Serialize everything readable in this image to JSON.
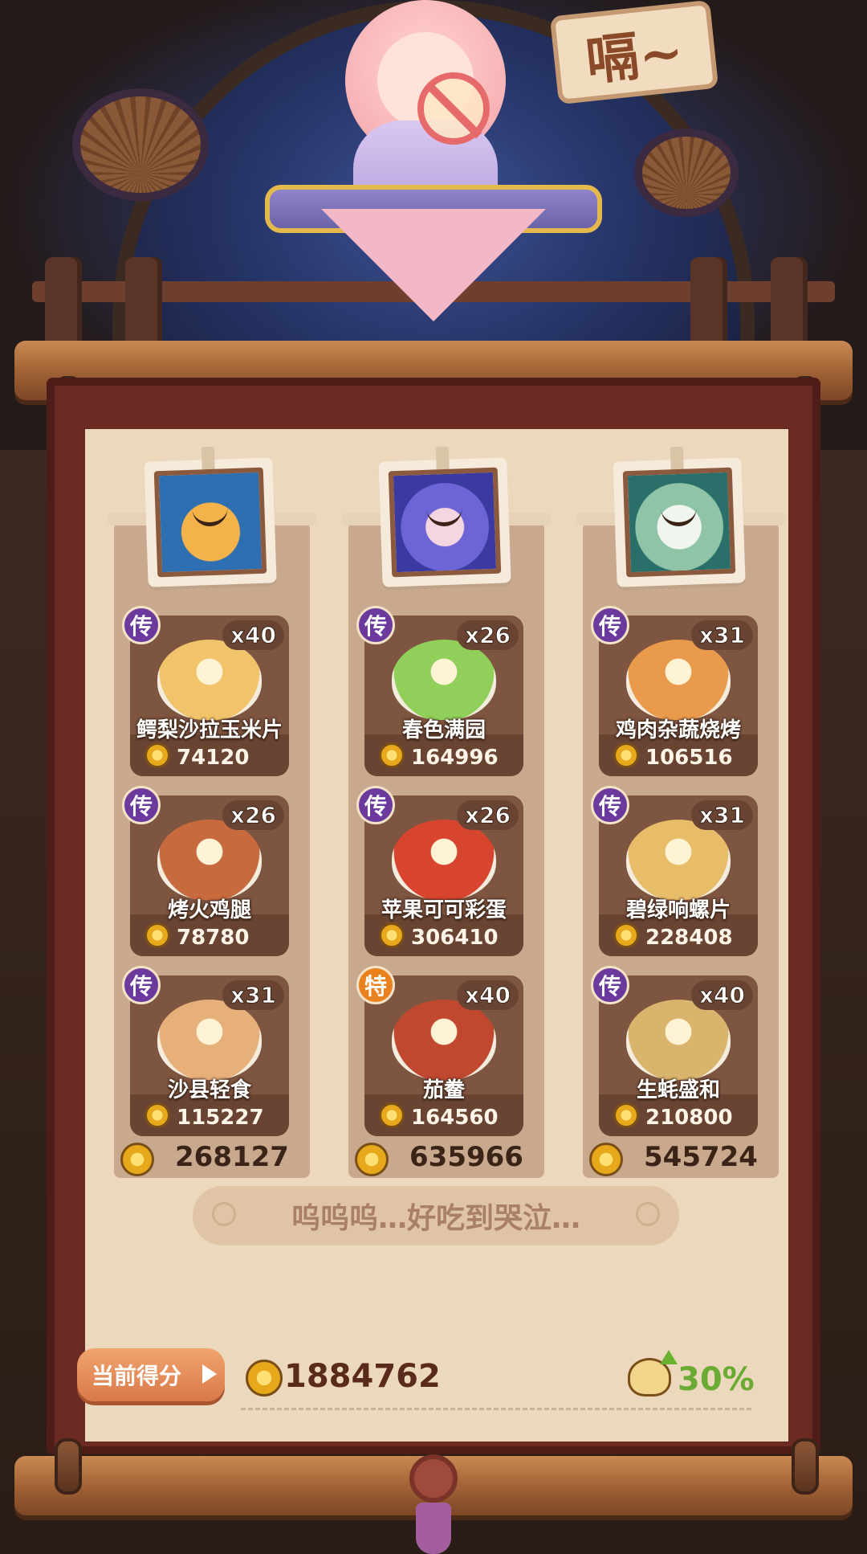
{
  "header": {
    "sign_text": "嗝~"
  },
  "columns": [
    {
      "character": "bear-hero",
      "dishes": [
        {
          "rarity": "传",
          "rarity_type": "legend",
          "count": "x40",
          "name": "鳄梨沙拉玉米片",
          "score": "74120",
          "color": "#f1c36a"
        },
        {
          "rarity": "传",
          "rarity_type": "legend",
          "count": "x26",
          "name": "烤火鸡腿",
          "score": "78780",
          "color": "#c76a3e"
        },
        {
          "rarity": "传",
          "rarity_type": "legend",
          "count": "x31",
          "name": "沙县轻食",
          "score": "115227",
          "color": "#e7b07a"
        }
      ],
      "total": "268127"
    },
    {
      "character": "purple-hair-hero",
      "dishes": [
        {
          "rarity": "传",
          "rarity_type": "legend",
          "count": "x26",
          "name": "春色满园",
          "score": "164996",
          "color": "#8fcf5a"
        },
        {
          "rarity": "传",
          "rarity_type": "legend",
          "count": "x26",
          "name": "苹果可可彩蛋",
          "score": "306410",
          "color": "#d8452f"
        },
        {
          "rarity": "特",
          "rarity_type": "special",
          "count": "x40",
          "name": "茄鲞",
          "score": "164560",
          "color": "#c0482e"
        }
      ],
      "total": "635966"
    },
    {
      "character": "white-hair-hero",
      "dishes": [
        {
          "rarity": "传",
          "rarity_type": "legend",
          "count": "x31",
          "name": "鸡肉杂蔬烧烤",
          "score": "106516",
          "color": "#e99a4a"
        },
        {
          "rarity": "传",
          "rarity_type": "legend",
          "count": "x31",
          "name": "碧绿响螺片",
          "score": "228408",
          "color": "#e8bd6a"
        },
        {
          "rarity": "传",
          "rarity_type": "legend",
          "count": "x40",
          "name": "生蚝盛和",
          "score": "210800",
          "color": "#d9b46c"
        }
      ],
      "total": "545724"
    }
  ],
  "quote": "呜呜呜…好吃到哭泣…",
  "footer": {
    "score_label": "当前得分",
    "total_score": "1884762",
    "bonus_percent": "30%"
  },
  "colors": {
    "legend_badge": "#6b3a9c",
    "special_badge": "#e9821e",
    "bonus_green": "#6bab34"
  }
}
